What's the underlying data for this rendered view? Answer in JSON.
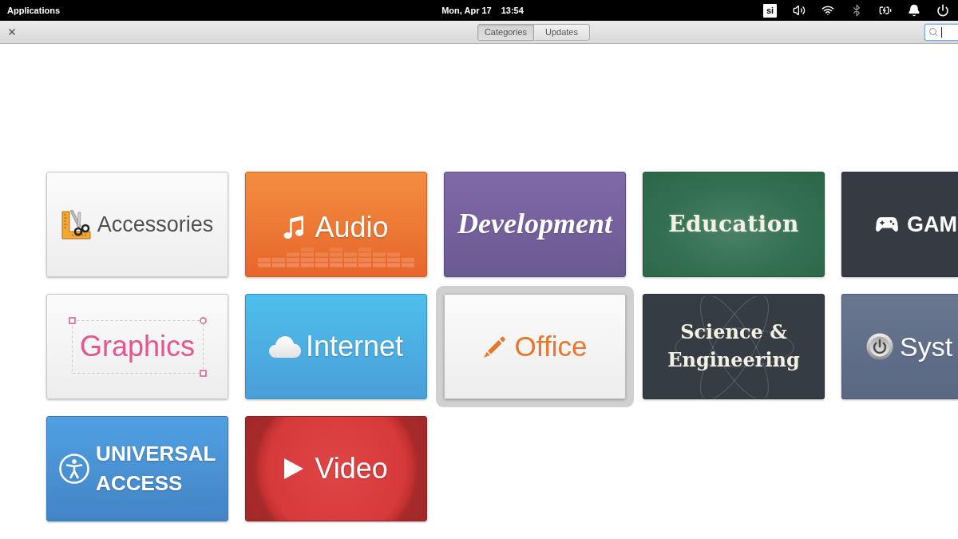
{
  "top_panel": {
    "menu": "Applications",
    "date": "Mon, Apr 17",
    "time": "13:54",
    "keyboard_layout": "si"
  },
  "toolbar": {
    "view_tabs": [
      {
        "label": "Categories",
        "selected": true
      },
      {
        "label": "Updates",
        "selected": false
      }
    ],
    "search": {
      "focused": true
    }
  },
  "categories": [
    {
      "label": "Accessories",
      "kind": "tools",
      "selected": false
    },
    {
      "label": "Audio",
      "kind": "music",
      "selected": false
    },
    {
      "label": "Development",
      "kind": "script",
      "selected": false
    },
    {
      "label": "Education",
      "kind": "chalkboard",
      "selected": false
    },
    {
      "label": "GAM",
      "kind": "gamepad",
      "selected": false
    },
    {
      "label": "Graphics",
      "kind": "selection",
      "selected": false
    },
    {
      "label": "Internet",
      "kind": "cloud",
      "selected": false
    },
    {
      "label": "Office",
      "kind": "pencil",
      "selected": true
    },
    {
      "label": "Science & Engineering",
      "kind": "atom",
      "selected": false
    },
    {
      "label": "Syst",
      "kind": "power",
      "selected": false
    },
    {
      "label": "UNIVERSAL ACCESS",
      "kind": "accessibility",
      "selected": false
    },
    {
      "label": "Video",
      "kind": "play",
      "selected": false
    }
  ]
}
